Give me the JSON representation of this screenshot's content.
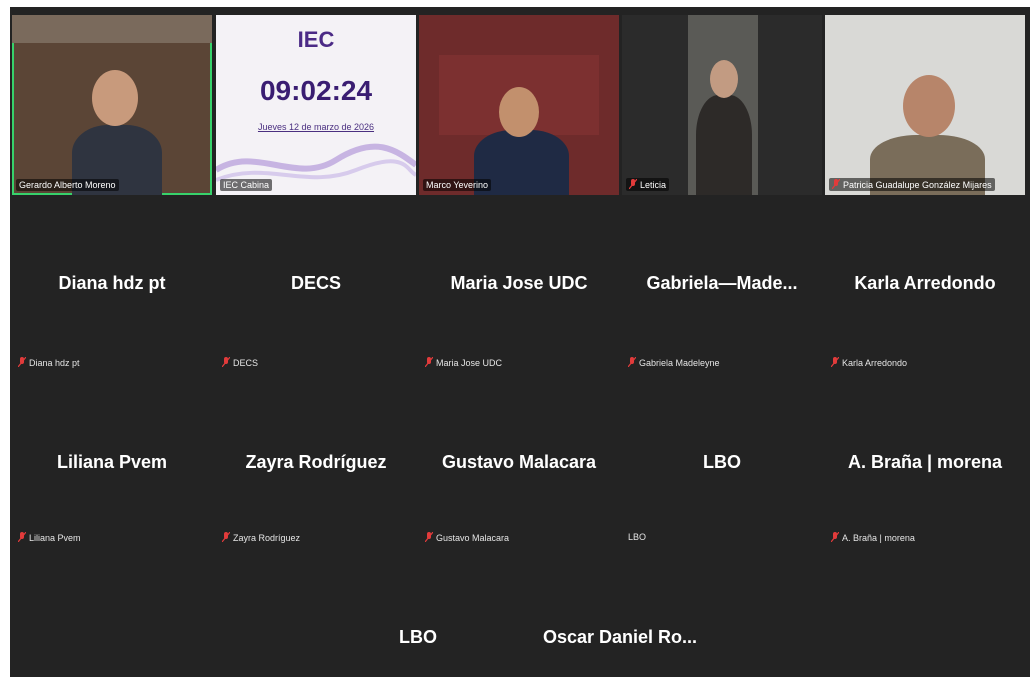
{
  "video_tiles": [
    {
      "name": "Gerardo Alberto Moreno",
      "active": true
    },
    {
      "name": "IEC Cabina"
    },
    {
      "name": "Marco Yeverino"
    },
    {
      "name": "Leticia"
    },
    {
      "name": "Patricia Guadalupe González Mijares"
    }
  ],
  "iec_screen": {
    "logo": "IEC",
    "clock": "09:02:24",
    "date": "Jueves 12 de marzo de 2026"
  },
  "participants_row1": [
    {
      "display": "Diana hdz pt",
      "tag": "Diana hdz pt"
    },
    {
      "display": "DECS",
      "tag": "DECS"
    },
    {
      "display": "Maria Jose UDC",
      "tag": "Maria Jose UDC"
    },
    {
      "display": "Gabriela—Made...",
      "tag": "Gabriela  Madeleyne"
    },
    {
      "display": "Karla Arredondo",
      "tag": "Karla Arredondo"
    }
  ],
  "participants_row2": [
    {
      "display": "Liliana Pvem",
      "tag": "Liliana Pvem"
    },
    {
      "display": "Zayra Rodríguez",
      "tag": "Zayra Rodríguez"
    },
    {
      "display": "Gustavo Malacara",
      "tag": "Gustavo Malacara"
    },
    {
      "display": "LBO",
      "tag": "LBO"
    },
    {
      "display": "A. Braña | morena",
      "tag": "A. Braña | morena"
    }
  ],
  "participants_row3": [
    {
      "display": "LBO"
    },
    {
      "display": "Oscar Daniel Ro..."
    }
  ],
  "colors": {
    "active_outline": "#37d26b",
    "muted_mic": "#e23b3b",
    "background": "#232323"
  }
}
